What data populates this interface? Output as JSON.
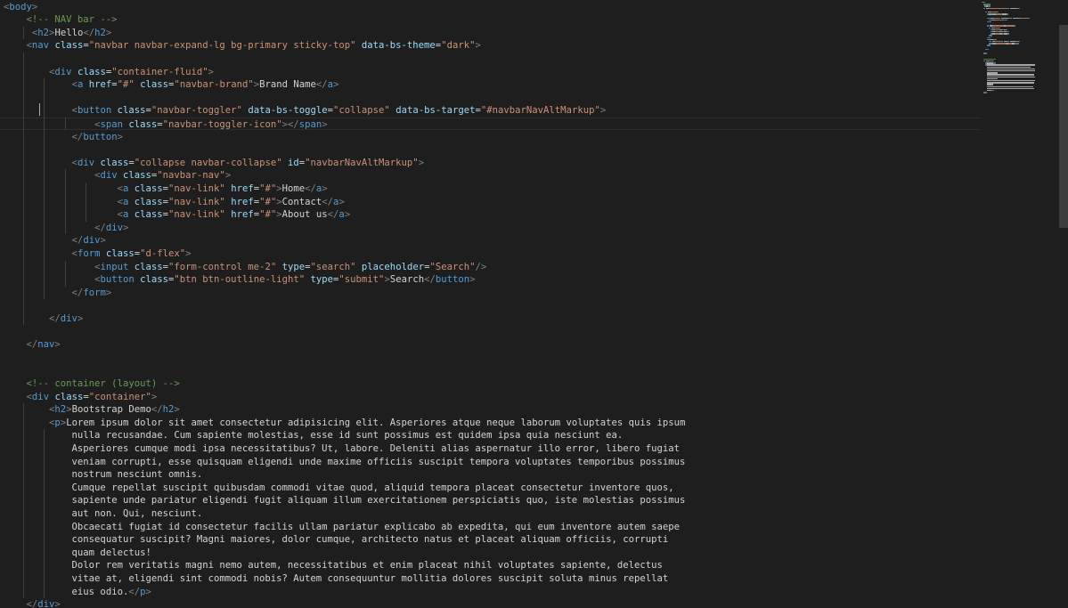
{
  "editor": {
    "language": "html",
    "cursor_line": 9,
    "colors": {
      "background": "#1e1e1e",
      "tag": "#569cd6",
      "attr": "#9cdcfe",
      "string": "#ce9178",
      "comment": "#6a9955",
      "punct": "#808080",
      "text": "#d4d4d4"
    },
    "lines": [
      [
        {
          "t": "<",
          "c": "punct"
        },
        {
          "t": "body",
          "c": "tag"
        },
        {
          "t": ">",
          "c": "punct"
        }
      ],
      [
        {
          "t": "    "
        },
        {
          "t": "<!-- NAV bar -->",
          "c": "comment"
        }
      ],
      [
        {
          "t": "     "
        },
        {
          "t": "<",
          "c": "punct"
        },
        {
          "t": "h2",
          "c": "tag"
        },
        {
          "t": ">",
          "c": "punct"
        },
        {
          "t": "Hello",
          "c": "text"
        },
        {
          "t": "</",
          "c": "punct"
        },
        {
          "t": "h2",
          "c": "tag"
        },
        {
          "t": ">",
          "c": "punct"
        }
      ],
      [
        {
          "t": "    "
        },
        {
          "t": "<",
          "c": "punct"
        },
        {
          "t": "nav",
          "c": "tag"
        },
        {
          "t": " "
        },
        {
          "t": "class",
          "c": "attr"
        },
        {
          "t": "=",
          "c": "text"
        },
        {
          "t": "\"navbar navbar-expand-lg bg-primary sticky-top\"",
          "c": "string"
        },
        {
          "t": " "
        },
        {
          "t": "data-bs-theme",
          "c": "attr"
        },
        {
          "t": "=",
          "c": "text"
        },
        {
          "t": "\"dark\"",
          "c": "string"
        },
        {
          "t": ">",
          "c": "punct"
        }
      ],
      [],
      [
        {
          "t": "        "
        },
        {
          "t": "<",
          "c": "punct"
        },
        {
          "t": "div",
          "c": "tag"
        },
        {
          "t": " "
        },
        {
          "t": "class",
          "c": "attr"
        },
        {
          "t": "=",
          "c": "text"
        },
        {
          "t": "\"container-fluid\"",
          "c": "string"
        },
        {
          "t": ">",
          "c": "punct"
        }
      ],
      [
        {
          "t": "            "
        },
        {
          "t": "<",
          "c": "punct"
        },
        {
          "t": "a",
          "c": "tag"
        },
        {
          "t": " "
        },
        {
          "t": "href",
          "c": "attr"
        },
        {
          "t": "=",
          "c": "text"
        },
        {
          "t": "\"#\"",
          "c": "string"
        },
        {
          "t": " "
        },
        {
          "t": "class",
          "c": "attr"
        },
        {
          "t": "=",
          "c": "text"
        },
        {
          "t": "\"navbar-brand\"",
          "c": "string"
        },
        {
          "t": ">",
          "c": "punct"
        },
        {
          "t": "Brand Name",
          "c": "text"
        },
        {
          "t": "</",
          "c": "punct"
        },
        {
          "t": "a",
          "c": "tag"
        },
        {
          "t": ">",
          "c": "punct"
        }
      ],
      [],
      [
        {
          "t": "            "
        },
        {
          "t": "<",
          "c": "punct"
        },
        {
          "t": "button",
          "c": "tag"
        },
        {
          "t": " "
        },
        {
          "t": "class",
          "c": "attr"
        },
        {
          "t": "=",
          "c": "text"
        },
        {
          "t": "\"navbar-toggler\"",
          "c": "string"
        },
        {
          "t": " "
        },
        {
          "t": "data-bs-toggle",
          "c": "attr"
        },
        {
          "t": "=",
          "c": "text"
        },
        {
          "t": "\"collapse\"",
          "c": "string"
        },
        {
          "t": " "
        },
        {
          "t": "data-bs-target",
          "c": "attr"
        },
        {
          "t": "=",
          "c": "text"
        },
        {
          "t": "\"#navbarNavAltMarkup\"",
          "c": "string"
        },
        {
          "t": ">",
          "c": "punct"
        }
      ],
      [
        {
          "t": "                "
        },
        {
          "t": "<",
          "c": "punct"
        },
        {
          "t": "span",
          "c": "tag"
        },
        {
          "t": " "
        },
        {
          "t": "class",
          "c": "attr"
        },
        {
          "t": "=",
          "c": "text"
        },
        {
          "t": "\"navbar-toggler-icon\"",
          "c": "string"
        },
        {
          "t": "></",
          "c": "punct"
        },
        {
          "t": "span",
          "c": "tag"
        },
        {
          "t": ">",
          "c": "punct"
        }
      ],
      [
        {
          "t": "            "
        },
        {
          "t": "</",
          "c": "punct"
        },
        {
          "t": "button",
          "c": "tag"
        },
        {
          "t": ">",
          "c": "punct"
        }
      ],
      [],
      [
        {
          "t": "            "
        },
        {
          "t": "<",
          "c": "punct"
        },
        {
          "t": "div",
          "c": "tag"
        },
        {
          "t": " "
        },
        {
          "t": "class",
          "c": "attr"
        },
        {
          "t": "=",
          "c": "text"
        },
        {
          "t": "\"collapse navbar-collapse\"",
          "c": "string"
        },
        {
          "t": " "
        },
        {
          "t": "id",
          "c": "attr"
        },
        {
          "t": "=",
          "c": "text"
        },
        {
          "t": "\"navbarNavAltMarkup\"",
          "c": "string"
        },
        {
          "t": ">",
          "c": "punct"
        }
      ],
      [
        {
          "t": "                "
        },
        {
          "t": "<",
          "c": "punct"
        },
        {
          "t": "div",
          "c": "tag"
        },
        {
          "t": " "
        },
        {
          "t": "class",
          "c": "attr"
        },
        {
          "t": "=",
          "c": "text"
        },
        {
          "t": "\"navbar-nav\"",
          "c": "string"
        },
        {
          "t": ">",
          "c": "punct"
        }
      ],
      [
        {
          "t": "                    "
        },
        {
          "t": "<",
          "c": "punct"
        },
        {
          "t": "a",
          "c": "tag"
        },
        {
          "t": " "
        },
        {
          "t": "class",
          "c": "attr"
        },
        {
          "t": "=",
          "c": "text"
        },
        {
          "t": "\"nav-link\"",
          "c": "string"
        },
        {
          "t": " "
        },
        {
          "t": "href",
          "c": "attr"
        },
        {
          "t": "=",
          "c": "text"
        },
        {
          "t": "\"#\"",
          "c": "string"
        },
        {
          "t": ">",
          "c": "punct"
        },
        {
          "t": "Home",
          "c": "text"
        },
        {
          "t": "</",
          "c": "punct"
        },
        {
          "t": "a",
          "c": "tag"
        },
        {
          "t": ">",
          "c": "punct"
        }
      ],
      [
        {
          "t": "                    "
        },
        {
          "t": "<",
          "c": "punct"
        },
        {
          "t": "a",
          "c": "tag"
        },
        {
          "t": " "
        },
        {
          "t": "class",
          "c": "attr"
        },
        {
          "t": "=",
          "c": "text"
        },
        {
          "t": "\"nav-link\"",
          "c": "string"
        },
        {
          "t": " "
        },
        {
          "t": "href",
          "c": "attr"
        },
        {
          "t": "=",
          "c": "text"
        },
        {
          "t": "\"#\"",
          "c": "string"
        },
        {
          "t": ">",
          "c": "punct"
        },
        {
          "t": "Contact",
          "c": "text"
        },
        {
          "t": "</",
          "c": "punct"
        },
        {
          "t": "a",
          "c": "tag"
        },
        {
          "t": ">",
          "c": "punct"
        }
      ],
      [
        {
          "t": "                    "
        },
        {
          "t": "<",
          "c": "punct"
        },
        {
          "t": "a",
          "c": "tag"
        },
        {
          "t": " "
        },
        {
          "t": "class",
          "c": "attr"
        },
        {
          "t": "=",
          "c": "text"
        },
        {
          "t": "\"nav-link\"",
          "c": "string"
        },
        {
          "t": " "
        },
        {
          "t": "href",
          "c": "attr"
        },
        {
          "t": "=",
          "c": "text"
        },
        {
          "t": "\"#\"",
          "c": "string"
        },
        {
          "t": ">",
          "c": "punct"
        },
        {
          "t": "About us",
          "c": "text"
        },
        {
          "t": "</",
          "c": "punct"
        },
        {
          "t": "a",
          "c": "tag"
        },
        {
          "t": ">",
          "c": "punct"
        }
      ],
      [
        {
          "t": "                "
        },
        {
          "t": "</",
          "c": "punct"
        },
        {
          "t": "div",
          "c": "tag"
        },
        {
          "t": ">",
          "c": "punct"
        }
      ],
      [
        {
          "t": "            "
        },
        {
          "t": "</",
          "c": "punct"
        },
        {
          "t": "div",
          "c": "tag"
        },
        {
          "t": ">",
          "c": "punct"
        }
      ],
      [
        {
          "t": "            "
        },
        {
          "t": "<",
          "c": "punct"
        },
        {
          "t": "form",
          "c": "tag"
        },
        {
          "t": " "
        },
        {
          "t": "class",
          "c": "attr"
        },
        {
          "t": "=",
          "c": "text"
        },
        {
          "t": "\"d-flex\"",
          "c": "string"
        },
        {
          "t": ">",
          "c": "punct"
        }
      ],
      [
        {
          "t": "                "
        },
        {
          "t": "<",
          "c": "punct"
        },
        {
          "t": "input",
          "c": "tag"
        },
        {
          "t": " "
        },
        {
          "t": "class",
          "c": "attr"
        },
        {
          "t": "=",
          "c": "text"
        },
        {
          "t": "\"form-control me-2\"",
          "c": "string"
        },
        {
          "t": " "
        },
        {
          "t": "type",
          "c": "attr"
        },
        {
          "t": "=",
          "c": "text"
        },
        {
          "t": "\"search\"",
          "c": "string"
        },
        {
          "t": " "
        },
        {
          "t": "placeholder",
          "c": "attr"
        },
        {
          "t": "=",
          "c": "text"
        },
        {
          "t": "\"Search\"",
          "c": "string"
        },
        {
          "t": "/>",
          "c": "punct"
        }
      ],
      [
        {
          "t": "                "
        },
        {
          "t": "<",
          "c": "punct"
        },
        {
          "t": "button",
          "c": "tag"
        },
        {
          "t": " "
        },
        {
          "t": "class",
          "c": "attr"
        },
        {
          "t": "=",
          "c": "text"
        },
        {
          "t": "\"btn btn-outline-light\"",
          "c": "string"
        },
        {
          "t": " "
        },
        {
          "t": "type",
          "c": "attr"
        },
        {
          "t": "=",
          "c": "text"
        },
        {
          "t": "\"submit\"",
          "c": "string"
        },
        {
          "t": ">",
          "c": "punct"
        },
        {
          "t": "Search",
          "c": "text"
        },
        {
          "t": "</",
          "c": "punct"
        },
        {
          "t": "button",
          "c": "tag"
        },
        {
          "t": ">",
          "c": "punct"
        }
      ],
      [
        {
          "t": "            "
        },
        {
          "t": "</",
          "c": "punct"
        },
        {
          "t": "form",
          "c": "tag"
        },
        {
          "t": ">",
          "c": "punct"
        }
      ],
      [],
      [
        {
          "t": "        "
        },
        {
          "t": "</",
          "c": "punct"
        },
        {
          "t": "div",
          "c": "tag"
        },
        {
          "t": ">",
          "c": "punct"
        }
      ],
      [],
      [
        {
          "t": "    "
        },
        {
          "t": "</",
          "c": "punct"
        },
        {
          "t": "nav",
          "c": "tag"
        },
        {
          "t": ">",
          "c": "punct"
        }
      ],
      [],
      [],
      [
        {
          "t": "    "
        },
        {
          "t": "<!-- container (layout) -->",
          "c": "comment"
        }
      ],
      [
        {
          "t": "    "
        },
        {
          "t": "<",
          "c": "punct"
        },
        {
          "t": "div",
          "c": "tag"
        },
        {
          "t": " "
        },
        {
          "t": "class",
          "c": "attr"
        },
        {
          "t": "=",
          "c": "text"
        },
        {
          "t": "\"container\"",
          "c": "string"
        },
        {
          "t": ">",
          "c": "punct"
        }
      ],
      [
        {
          "t": "        "
        },
        {
          "t": "<",
          "c": "punct"
        },
        {
          "t": "h2",
          "c": "tag"
        },
        {
          "t": ">",
          "c": "punct"
        },
        {
          "t": "Bootstrap Demo",
          "c": "text"
        },
        {
          "t": "</",
          "c": "punct"
        },
        {
          "t": "h2",
          "c": "tag"
        },
        {
          "t": ">",
          "c": "punct"
        }
      ],
      [
        {
          "t": "        "
        },
        {
          "t": "<",
          "c": "punct"
        },
        {
          "t": "p",
          "c": "tag"
        },
        {
          "t": ">",
          "c": "punct"
        },
        {
          "t": "Lorem ipsum dolor sit amet consectetur adipisicing elit. Asperiores atque neque laborum voluptates quis ipsum",
          "c": "text"
        }
      ],
      [
        {
          "t": "            "
        },
        {
          "t": "nulla recusandae. Cum sapiente molestias, esse id sunt possimus est quidem ipsa quia nesciunt ea.",
          "c": "text"
        }
      ],
      [
        {
          "t": "            "
        },
        {
          "t": "Asperiores cumque modi ipsa necessitatibus? Ut, labore. Deleniti alias aspernatur illo error, libero fugiat",
          "c": "text"
        }
      ],
      [
        {
          "t": "            "
        },
        {
          "t": "veniam corrupti, esse quisquam eligendi unde maxime officiis suscipit tempora voluptates temporibus possimus",
          "c": "text"
        }
      ],
      [
        {
          "t": "            "
        },
        {
          "t": "nostrum nesciunt omnis.",
          "c": "text"
        }
      ],
      [
        {
          "t": "            "
        },
        {
          "t": "Cumque repellat suscipit quibusdam commodi vitae quod, aliquid tempora placeat consectetur inventore quos,",
          "c": "text"
        }
      ],
      [
        {
          "t": "            "
        },
        {
          "t": "sapiente unde pariatur eligendi fugit aliquam illum exercitationem perspiciatis quo, iste molestias possimus",
          "c": "text"
        }
      ],
      [
        {
          "t": "            "
        },
        {
          "t": "aut non. Qui, nesciunt.",
          "c": "text"
        }
      ],
      [
        {
          "t": "            "
        },
        {
          "t": "Obcaecati fugiat id consectetur facilis ullam pariatur explicabo ab expedita, qui eum inventore autem saepe",
          "c": "text"
        }
      ],
      [
        {
          "t": "            "
        },
        {
          "t": "consequatur suscipit? Magni maiores, dolor cumque, architecto natus et placeat aliquam officiis, corrupti",
          "c": "text"
        }
      ],
      [
        {
          "t": "            "
        },
        {
          "t": "quam delectus!",
          "c": "text"
        }
      ],
      [
        {
          "t": "            "
        },
        {
          "t": "Dolor rem veritatis magni nemo autem, necessitatibus et enim placeat nihil voluptates sapiente, delectus",
          "c": "text"
        }
      ],
      [
        {
          "t": "            "
        },
        {
          "t": "vitae at, eligendi sint commodi nobis? Autem consequuntur mollitia dolores suscipit soluta minus repellat",
          "c": "text"
        }
      ],
      [
        {
          "t": "            "
        },
        {
          "t": "eius odio.",
          "c": "text"
        },
        {
          "t": "</",
          "c": "punct"
        },
        {
          "t": "p",
          "c": "tag"
        },
        {
          "t": ">",
          "c": "punct"
        }
      ],
      [
        {
          "t": "    "
        },
        {
          "t": "</",
          "c": "punct"
        },
        {
          "t": "div",
          "c": "tag"
        },
        {
          "t": ">",
          "c": "punct"
        }
      ]
    ]
  }
}
